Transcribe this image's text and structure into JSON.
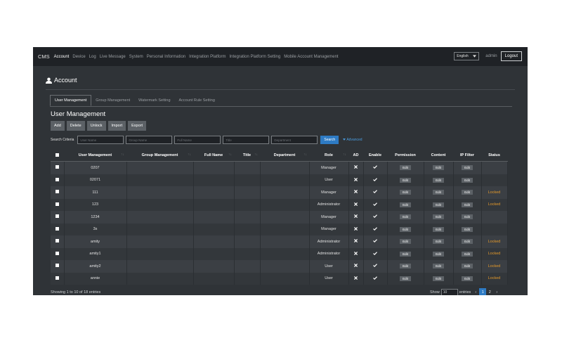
{
  "nav": {
    "brand": "CMS",
    "items": [
      "Account",
      "Device",
      "Log",
      "Live Message",
      "System",
      "Personal Information",
      "Integration Platform",
      "Integration Platform Setting",
      "Mobile Account Management"
    ],
    "language": "English",
    "user": "admin",
    "logout_label": "Logout"
  },
  "page": {
    "header": "Account",
    "tabs": [
      "User Management",
      "Group Management",
      "Watermark Setting",
      "Account Rule Setting"
    ],
    "title": "User Management"
  },
  "toolbar": {
    "buttons": [
      "Add",
      "Delete",
      "Unlock",
      "Import",
      "Export"
    ]
  },
  "search": {
    "label": "Search Criteria",
    "placeholders": [
      "User Name",
      "Group Name",
      "Full Name",
      "Title",
      "Department"
    ],
    "button": "Search",
    "advanced": "Advanced"
  },
  "table": {
    "columns": [
      "",
      "User Management",
      "Group Management",
      "Full Name",
      "Title",
      "Department",
      "Role",
      "AD",
      "Enable",
      "Permission",
      "Content",
      "IP Filter",
      "Status"
    ],
    "edit_label": "Edit",
    "rows": [
      {
        "user": "0207",
        "role": "Manager",
        "status": ""
      },
      {
        "user": "02071",
        "role": "User",
        "status": ""
      },
      {
        "user": "111",
        "role": "Manager",
        "status": "Locked"
      },
      {
        "user": "123",
        "role": "Administrator",
        "status": "Locked"
      },
      {
        "user": "1234",
        "role": "Manager",
        "status": ""
      },
      {
        "user": "3s",
        "role": "Manager",
        "status": ""
      },
      {
        "user": "amity",
        "role": "Administrator",
        "status": "Locked"
      },
      {
        "user": "amity1",
        "role": "Administrator",
        "status": "Locked"
      },
      {
        "user": "amity2",
        "role": "User",
        "status": "Locked"
      },
      {
        "user": "annie",
        "role": "User",
        "status": "Locked"
      }
    ]
  },
  "footer": {
    "info": "Showing 1 to 10 of 18 entries",
    "show_label": "Show",
    "entries_value": "10",
    "entries_label": "entries",
    "pages": [
      "1",
      "2"
    ],
    "prev": "‹",
    "next": "›"
  },
  "colors": {
    "accent": "#2e7bc4",
    "locked": "#e59a2a",
    "background": "#2f3337",
    "navbar": "#1f2226"
  },
  "icons": {
    "header": "user-icon",
    "search_advanced": "caret-down-icon",
    "check": "checkmark-icon",
    "ad": "cross-icon"
  }
}
